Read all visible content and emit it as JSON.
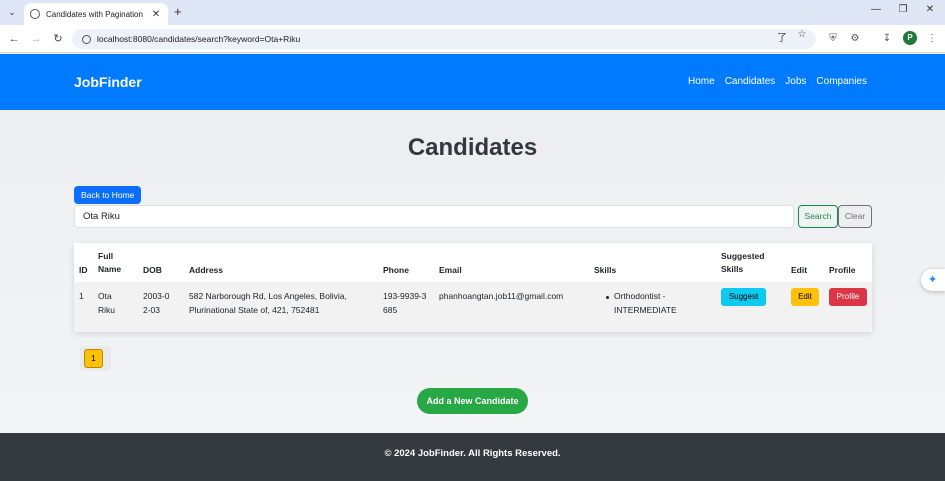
{
  "browser": {
    "tab_title": "Candidates with Pagination",
    "url": "localhost:8080/candidates/search?keyword=Ota+Riku",
    "profile_initial": "P"
  },
  "navbar": {
    "brand": "JobFinder",
    "links": [
      "Home",
      "Candidates",
      "Jobs",
      "Companies"
    ]
  },
  "page": {
    "title": "Candidates",
    "back_button": "Back to Home",
    "search_value": "Ota Riku",
    "search_button": "Search",
    "clear_button": "Clear"
  },
  "table": {
    "headers": [
      "ID",
      "Full Name",
      "DOB",
      "Address",
      "Phone",
      "Email",
      "Skills",
      "Suggested Skills",
      "Edit",
      "Profile"
    ],
    "rows": [
      {
        "id": "1",
        "full_name": "Ota Riku",
        "dob": "2003-02-03",
        "address": "582 Narborough Rd, Los Angeles, Bolivia, Plurinational State of, 421, 752481",
        "phone": "193-9939-3685",
        "email": "phanhoangtan.job11@gmail.com",
        "skills": [
          "Orthodontist - INTERMEDIATE"
        ],
        "suggest_label": "Suggest",
        "edit_label": "Edit",
        "profile_label": "Profile"
      }
    ]
  },
  "pagination": {
    "current_page": "1"
  },
  "add_button": "Add a New Candidate",
  "footer": {
    "text": "© 2024 JobFinder. All Rights Reserved."
  },
  "colors": {
    "navbar": "#007bff",
    "footer": "#343a40",
    "add_button": "#28a745",
    "suggest": "#0dcaf0",
    "edit": "#ffc107",
    "profile": "#dc3545"
  }
}
